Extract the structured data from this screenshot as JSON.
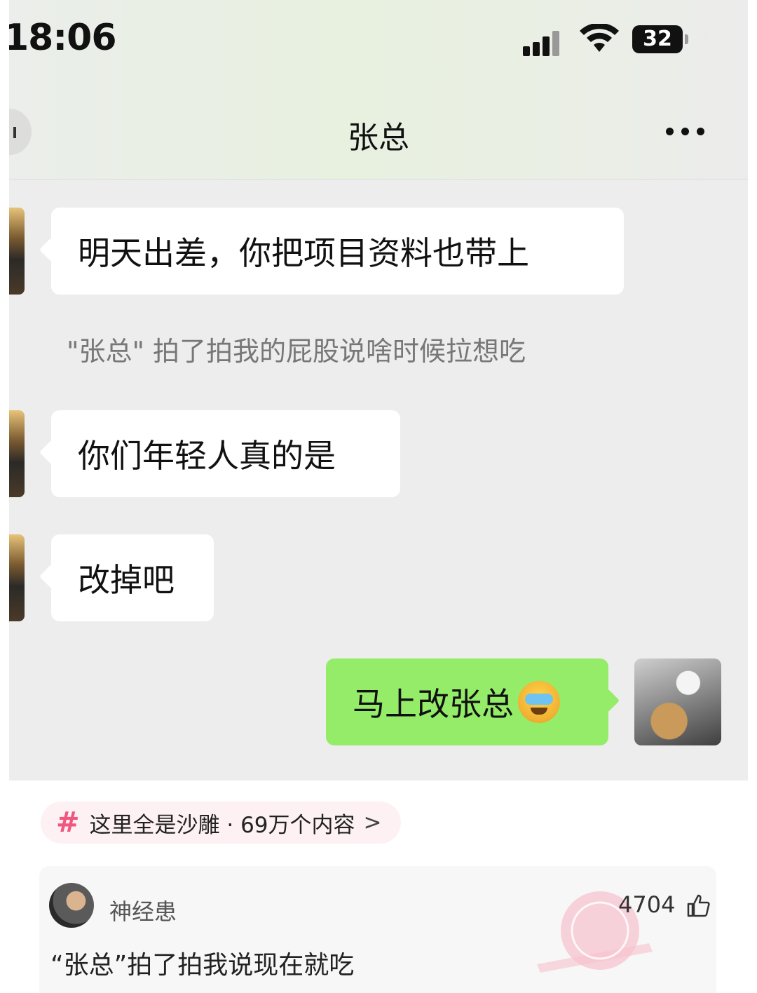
{
  "status_bar": {
    "time": "18:06",
    "battery": "32"
  },
  "chat": {
    "title": "张总",
    "messages": [
      {
        "side": "left",
        "text": "明天出差，你把项目资料也带上"
      },
      {
        "side": "left",
        "text": "你们年轻人真的是"
      },
      {
        "side": "left",
        "text": "改掉吧"
      },
      {
        "side": "right",
        "text": "马上改张总"
      }
    ],
    "system_notice": "\"张总\" 拍了拍我的屁股说啥时候拉想吃"
  },
  "topic": {
    "hash": "#",
    "label": "这里全是沙雕 · 69万个内容",
    "chevron": ">"
  },
  "comment": {
    "username": "神经患",
    "text": "“张总”拍了拍我说现在就吃",
    "likes": "4704"
  },
  "colors": {
    "chat_bg": "#ededed",
    "sent_bubble": "#95ec69",
    "topic_accent": "#f0567e",
    "watermark": "#f3a7b8"
  },
  "icons": [
    "back-icon",
    "more-icon",
    "signal-icon",
    "wifi-icon",
    "battery-icon",
    "crying-laughing-emoji-icon",
    "thumbs-up-icon",
    "hashtag-icon"
  ]
}
